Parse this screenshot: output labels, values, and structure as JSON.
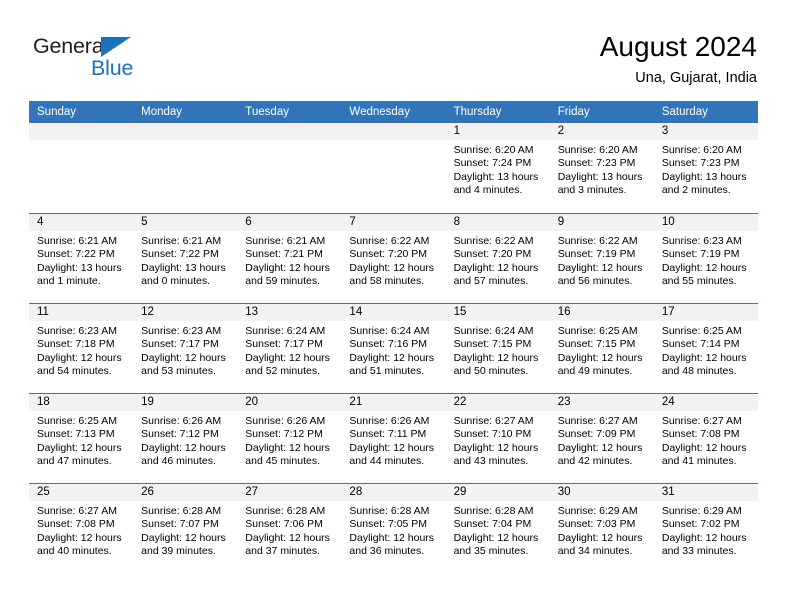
{
  "brand": {
    "name_part1": "General",
    "name_part2": "Blue",
    "triangle_color": "#1c72bb"
  },
  "header": {
    "title": "August 2024",
    "subtitle": "Una, Gujarat, India",
    "accent_color": "#3175b8",
    "band_color": "#f2f2f2"
  },
  "calendar": {
    "day_names": [
      "Sunday",
      "Monday",
      "Tuesday",
      "Wednesday",
      "Thursday",
      "Friday",
      "Saturday"
    ],
    "weeks": [
      [
        {
          "date": "",
          "empty": true
        },
        {
          "date": "",
          "empty": true
        },
        {
          "date": "",
          "empty": true
        },
        {
          "date": "",
          "empty": true
        },
        {
          "date": "1",
          "sunrise": "Sunrise: 6:20 AM",
          "sunset": "Sunset: 7:24 PM",
          "daylight_l1": "Daylight: 13 hours",
          "daylight_l2": "and 4 minutes."
        },
        {
          "date": "2",
          "sunrise": "Sunrise: 6:20 AM",
          "sunset": "Sunset: 7:23 PM",
          "daylight_l1": "Daylight: 13 hours",
          "daylight_l2": "and 3 minutes."
        },
        {
          "date": "3",
          "sunrise": "Sunrise: 6:20 AM",
          "sunset": "Sunset: 7:23 PM",
          "daylight_l1": "Daylight: 13 hours",
          "daylight_l2": "and 2 minutes."
        }
      ],
      [
        {
          "date": "4",
          "sunrise": "Sunrise: 6:21 AM",
          "sunset": "Sunset: 7:22 PM",
          "daylight_l1": "Daylight: 13 hours",
          "daylight_l2": "and 1 minute."
        },
        {
          "date": "5",
          "sunrise": "Sunrise: 6:21 AM",
          "sunset": "Sunset: 7:22 PM",
          "daylight_l1": "Daylight: 13 hours",
          "daylight_l2": "and 0 minutes."
        },
        {
          "date": "6",
          "sunrise": "Sunrise: 6:21 AM",
          "sunset": "Sunset: 7:21 PM",
          "daylight_l1": "Daylight: 12 hours",
          "daylight_l2": "and 59 minutes."
        },
        {
          "date": "7",
          "sunrise": "Sunrise: 6:22 AM",
          "sunset": "Sunset: 7:20 PM",
          "daylight_l1": "Daylight: 12 hours",
          "daylight_l2": "and 58 minutes."
        },
        {
          "date": "8",
          "sunrise": "Sunrise: 6:22 AM",
          "sunset": "Sunset: 7:20 PM",
          "daylight_l1": "Daylight: 12 hours",
          "daylight_l2": "and 57 minutes."
        },
        {
          "date": "9",
          "sunrise": "Sunrise: 6:22 AM",
          "sunset": "Sunset: 7:19 PM",
          "daylight_l1": "Daylight: 12 hours",
          "daylight_l2": "and 56 minutes."
        },
        {
          "date": "10",
          "sunrise": "Sunrise: 6:23 AM",
          "sunset": "Sunset: 7:19 PM",
          "daylight_l1": "Daylight: 12 hours",
          "daylight_l2": "and 55 minutes."
        }
      ],
      [
        {
          "date": "11",
          "sunrise": "Sunrise: 6:23 AM",
          "sunset": "Sunset: 7:18 PM",
          "daylight_l1": "Daylight: 12 hours",
          "daylight_l2": "and 54 minutes."
        },
        {
          "date": "12",
          "sunrise": "Sunrise: 6:23 AM",
          "sunset": "Sunset: 7:17 PM",
          "daylight_l1": "Daylight: 12 hours",
          "daylight_l2": "and 53 minutes."
        },
        {
          "date": "13",
          "sunrise": "Sunrise: 6:24 AM",
          "sunset": "Sunset: 7:17 PM",
          "daylight_l1": "Daylight: 12 hours",
          "daylight_l2": "and 52 minutes."
        },
        {
          "date": "14",
          "sunrise": "Sunrise: 6:24 AM",
          "sunset": "Sunset: 7:16 PM",
          "daylight_l1": "Daylight: 12 hours",
          "daylight_l2": "and 51 minutes."
        },
        {
          "date": "15",
          "sunrise": "Sunrise: 6:24 AM",
          "sunset": "Sunset: 7:15 PM",
          "daylight_l1": "Daylight: 12 hours",
          "daylight_l2": "and 50 minutes."
        },
        {
          "date": "16",
          "sunrise": "Sunrise: 6:25 AM",
          "sunset": "Sunset: 7:15 PM",
          "daylight_l1": "Daylight: 12 hours",
          "daylight_l2": "and 49 minutes."
        },
        {
          "date": "17",
          "sunrise": "Sunrise: 6:25 AM",
          "sunset": "Sunset: 7:14 PM",
          "daylight_l1": "Daylight: 12 hours",
          "daylight_l2": "and 48 minutes."
        }
      ],
      [
        {
          "date": "18",
          "sunrise": "Sunrise: 6:25 AM",
          "sunset": "Sunset: 7:13 PM",
          "daylight_l1": "Daylight: 12 hours",
          "daylight_l2": "and 47 minutes."
        },
        {
          "date": "19",
          "sunrise": "Sunrise: 6:26 AM",
          "sunset": "Sunset: 7:12 PM",
          "daylight_l1": "Daylight: 12 hours",
          "daylight_l2": "and 46 minutes."
        },
        {
          "date": "20",
          "sunrise": "Sunrise: 6:26 AM",
          "sunset": "Sunset: 7:12 PM",
          "daylight_l1": "Daylight: 12 hours",
          "daylight_l2": "and 45 minutes."
        },
        {
          "date": "21",
          "sunrise": "Sunrise: 6:26 AM",
          "sunset": "Sunset: 7:11 PM",
          "daylight_l1": "Daylight: 12 hours",
          "daylight_l2": "and 44 minutes."
        },
        {
          "date": "22",
          "sunrise": "Sunrise: 6:27 AM",
          "sunset": "Sunset: 7:10 PM",
          "daylight_l1": "Daylight: 12 hours",
          "daylight_l2": "and 43 minutes."
        },
        {
          "date": "23",
          "sunrise": "Sunrise: 6:27 AM",
          "sunset": "Sunset: 7:09 PM",
          "daylight_l1": "Daylight: 12 hours",
          "daylight_l2": "and 42 minutes."
        },
        {
          "date": "24",
          "sunrise": "Sunrise: 6:27 AM",
          "sunset": "Sunset: 7:08 PM",
          "daylight_l1": "Daylight: 12 hours",
          "daylight_l2": "and 41 minutes."
        }
      ],
      [
        {
          "date": "25",
          "sunrise": "Sunrise: 6:27 AM",
          "sunset": "Sunset: 7:08 PM",
          "daylight_l1": "Daylight: 12 hours",
          "daylight_l2": "and 40 minutes."
        },
        {
          "date": "26",
          "sunrise": "Sunrise: 6:28 AM",
          "sunset": "Sunset: 7:07 PM",
          "daylight_l1": "Daylight: 12 hours",
          "daylight_l2": "and 39 minutes."
        },
        {
          "date": "27",
          "sunrise": "Sunrise: 6:28 AM",
          "sunset": "Sunset: 7:06 PM",
          "daylight_l1": "Daylight: 12 hours",
          "daylight_l2": "and 37 minutes."
        },
        {
          "date": "28",
          "sunrise": "Sunrise: 6:28 AM",
          "sunset": "Sunset: 7:05 PM",
          "daylight_l1": "Daylight: 12 hours",
          "daylight_l2": "and 36 minutes."
        },
        {
          "date": "29",
          "sunrise": "Sunrise: 6:28 AM",
          "sunset": "Sunset: 7:04 PM",
          "daylight_l1": "Daylight: 12 hours",
          "daylight_l2": "and 35 minutes."
        },
        {
          "date": "30",
          "sunrise": "Sunrise: 6:29 AM",
          "sunset": "Sunset: 7:03 PM",
          "daylight_l1": "Daylight: 12 hours",
          "daylight_l2": "and 34 minutes."
        },
        {
          "date": "31",
          "sunrise": "Sunrise: 6:29 AM",
          "sunset": "Sunset: 7:02 PM",
          "daylight_l1": "Daylight: 12 hours",
          "daylight_l2": "and 33 minutes."
        }
      ]
    ]
  }
}
